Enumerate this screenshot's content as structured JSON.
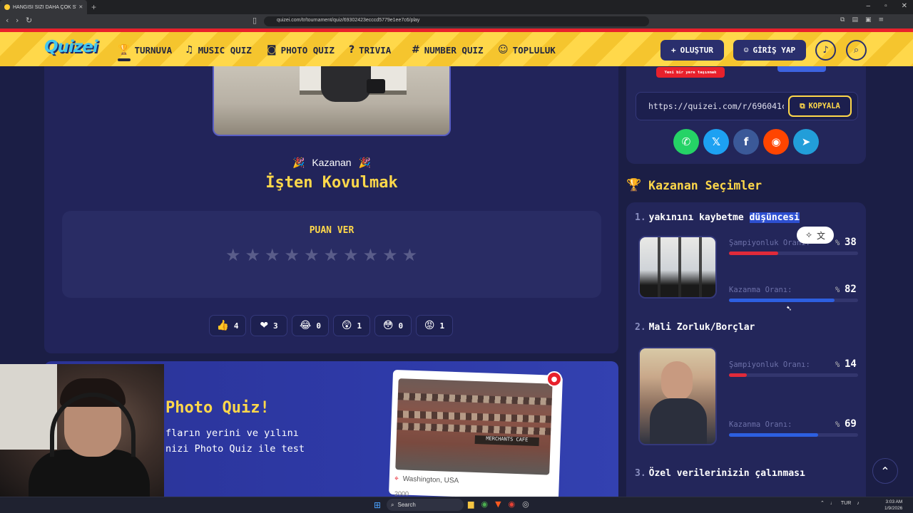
{
  "browser": {
    "tab_title": "HANGİSİ SİZİ DAHA ÇOK STRESE",
    "url": "quizei.com/tr/tournament/quiz/69302423ecccd5779e1ee7c6/play"
  },
  "header": {
    "logo": "Quizei",
    "nav": [
      {
        "label": "TURNUVA",
        "icon": "trophy-icon"
      },
      {
        "label": "MUSIC QUIZ",
        "icon": "music-icon"
      },
      {
        "label": "PHOTO QUIZ",
        "icon": "camera-icon"
      },
      {
        "label": "TRIVIA",
        "icon": "chat-question-icon"
      },
      {
        "label": "NUMBER QUIZ",
        "icon": "hash-icon"
      },
      {
        "label": "TOPLULUK",
        "icon": "users-icon"
      }
    ],
    "create_label": "OLUŞTUR",
    "login_label": "GİRİŞ YAP"
  },
  "main": {
    "winner_label": "Kazanan",
    "winner_title": "İşten Kovulmak",
    "rate_title": "PUAN VER",
    "star_count": 10,
    "reactions": [
      {
        "emoji": "👍",
        "count": "4"
      },
      {
        "emoji": "❤",
        "count": "3"
      },
      {
        "emoji": "😂",
        "count": "0"
      },
      {
        "emoji": "😲",
        "count": "1"
      },
      {
        "emoji": "😳",
        "count": "0"
      },
      {
        "emoji": "😡",
        "count": "1"
      }
    ]
  },
  "photo_quiz": {
    "title": "Photo Quiz!",
    "desc_line1": "fların yerini ve yılını",
    "desc_line2": "nizi Photo Quiz ile test",
    "location": "Washington, USA",
    "year": "2000",
    "sign": "MERCHANTS CAFE"
  },
  "share": {
    "tooltip": "Yeni bir yere taşınmak",
    "link": "https://quizei.com/r/696041cfc",
    "copy_label": "KOPYALA",
    "socials": [
      {
        "name": "whatsapp",
        "glyph": "✆",
        "color": "#25d366"
      },
      {
        "name": "x",
        "glyph": "𝕏",
        "color": "#1da1f2"
      },
      {
        "name": "facebook",
        "glyph": "f",
        "color": "#3b5998"
      },
      {
        "name": "reddit",
        "glyph": "◉",
        "color": "#ff4500"
      },
      {
        "name": "telegram",
        "glyph": "➤",
        "color": "#229ed9"
      }
    ]
  },
  "choices": {
    "title": "Kazanan Seçimler",
    "items": [
      {
        "num": "1.",
        "title_plain": "yakınını kaybetme ",
        "title_hl": "düşüncesi",
        "champ_label": "Şampiyonluk Oranı:",
        "champ_pct": "%",
        "champ_value": "38",
        "champ_fraction": 0.38,
        "win_label": "Kazanma Oranı:",
        "win_pct": "%",
        "win_value": "82",
        "win_fraction": 0.82
      },
      {
        "num": "2.",
        "title_plain": "Mali Zorluk/Borçlar",
        "title_hl": "",
        "champ_label": "Şampiyonluk Oranı:",
        "champ_pct": "%",
        "champ_value": "14",
        "champ_fraction": 0.14,
        "win_label": "Kazanma Oranı:",
        "win_pct": "%",
        "win_value": "69",
        "win_fraction": 0.69
      },
      {
        "num": "3.",
        "title_plain": "Özel verilerinizin çalınması",
        "title_hl": ""
      }
    ]
  },
  "taskbar": {
    "search": "Search",
    "lang": "TUR",
    "time": "3:03 AM",
    "date": "1/9/2026"
  }
}
